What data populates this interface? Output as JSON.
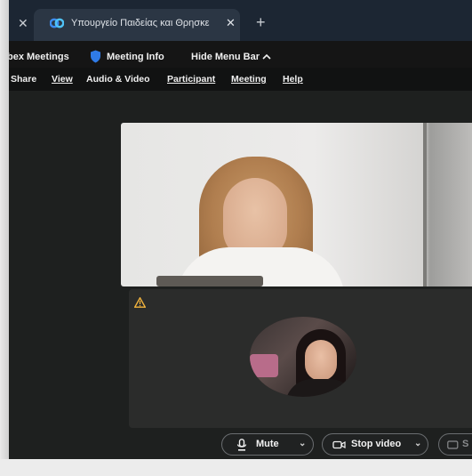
{
  "browser": {
    "tab_title": "Υπουργείο Παιδείας και Θρησκε",
    "tab_close": "✕",
    "prev_tab_close": "✕",
    "new_tab": "+"
  },
  "webex": {
    "app_title": "bex Meetings",
    "meeting_info": "Meeting Info",
    "hide_menu_bar": "Hide Menu Bar",
    "hide_menu_chevron": "^"
  },
  "menu": {
    "share": "Share",
    "view": "View",
    "audio_video": "Audio & Video",
    "participant": "Participant",
    "meeting": "Meeting",
    "help": "Help"
  },
  "controls": {
    "mute": "Mute",
    "stop_video": "Stop video",
    "share_partial": "S",
    "chevron": "⌄"
  },
  "colors": {
    "accent_blue": "#1f6fd6",
    "warning": "#f2b33d",
    "background": "#1e201f"
  },
  "icons": {
    "tab_favicon": "webex-icon",
    "meeting_info": "shield-icon",
    "mute": "microphone-icon",
    "video": "video-camera-icon",
    "self_tile": "warning-icon"
  }
}
